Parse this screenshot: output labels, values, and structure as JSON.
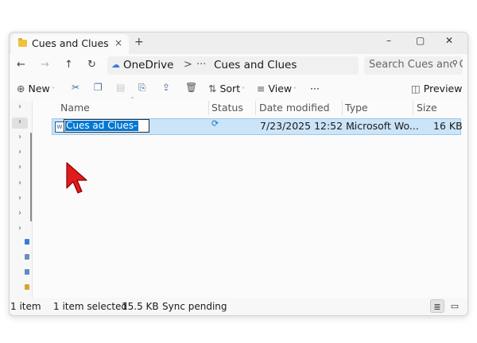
{
  "tab": {
    "title": "Cues and Clues",
    "close_glyph": "×",
    "new_tab_glyph": "+"
  },
  "window_controls": {
    "minimize": "–",
    "maximize": "▢",
    "close": "✕"
  },
  "address": {
    "back_glyph": "←",
    "forward_glyph": "→",
    "up_glyph": "↑",
    "refresh_glyph": "↻",
    "crumbs": [
      "OneDrive",
      "Cues and Clues"
    ],
    "separator": ">",
    "more_glyph": "···"
  },
  "search": {
    "placeholder": "Search Cues and Clues",
    "icon": "search-icon"
  },
  "toolbar": {
    "new_label": "New",
    "sort_label": "Sort",
    "view_label": "View",
    "more_glyph": "···",
    "preview_label": "Preview"
  },
  "columns": {
    "name": "Name",
    "status": "Status",
    "date_modified": "Date modified",
    "type": "Type",
    "size": "Size"
  },
  "files": [
    {
      "name": "Cues ad Clues-",
      "status_icon": "sync-pending-icon",
      "date_modified": "7/23/2025 12:52 ...",
      "type": "Microsoft Wo...",
      "size": "16 KB",
      "renaming": true
    }
  ],
  "status": {
    "item_count": "1 item",
    "selected": "1 item selected",
    "selected_size": "15.5 KB",
    "sync": "Sync pending"
  },
  "colors": {
    "accent": "#0078d4",
    "selection_bg": "#cce4f7",
    "cursor": "#e01b1b",
    "folder": "#f1c040"
  }
}
